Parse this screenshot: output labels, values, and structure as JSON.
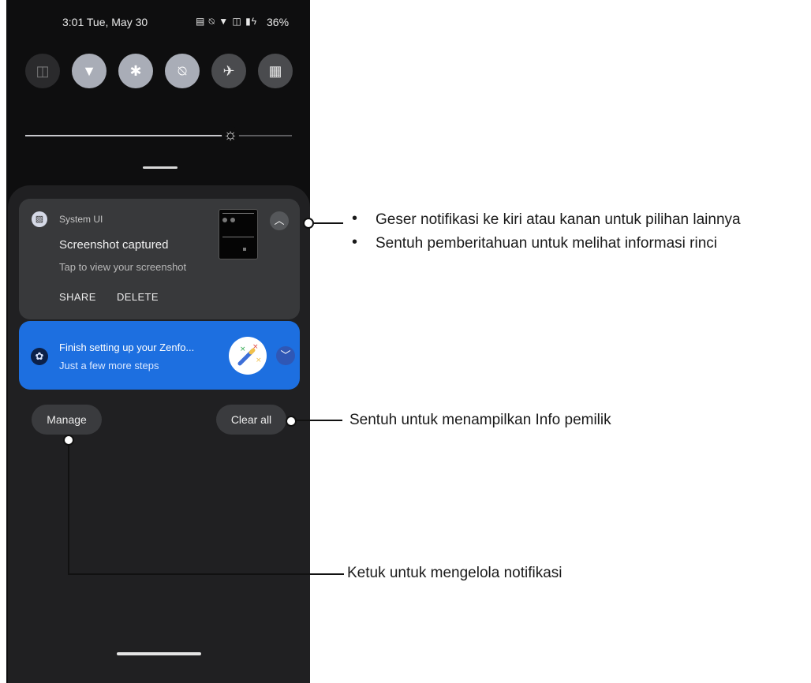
{
  "status_bar": {
    "time": "3:01",
    "date": "Tue, May 30",
    "battery": "36%"
  },
  "quick_settings": {
    "tiles": [
      {
        "name": "no-sim-icon",
        "state": "off"
      },
      {
        "name": "wifi-icon",
        "state": "on"
      },
      {
        "name": "bluetooth-icon",
        "state": "on"
      },
      {
        "name": "mute-icon",
        "state": "on"
      },
      {
        "name": "airplane-icon",
        "state": "inactive"
      },
      {
        "name": "qr-code-icon",
        "state": "inactive"
      }
    ],
    "brightness_level": 0.77
  },
  "notifications": [
    {
      "app": "System UI",
      "title": "Screenshot captured",
      "body": "Tap to view your screenshot",
      "actions": [
        "SHARE",
        "DELETE"
      ],
      "expanded": true
    },
    {
      "title": "Finish setting up your Zenfo...",
      "body": "Just a few more steps",
      "expanded": false,
      "background": "#1d6fe0"
    }
  ],
  "buttons": {
    "manage": "Manage",
    "clear_all": "Clear all"
  },
  "callouts": {
    "notification_tips": [
      "Geser notifikasi ke kiri atau kanan untuk pilihan lainnya",
      "Sentuh pemberitahuan untuk melihat informasi rinci"
    ],
    "clear_all": "Sentuh untuk menampilkan Info pemilik",
    "manage": "Ketuk untuk mengelola notifikasi"
  }
}
